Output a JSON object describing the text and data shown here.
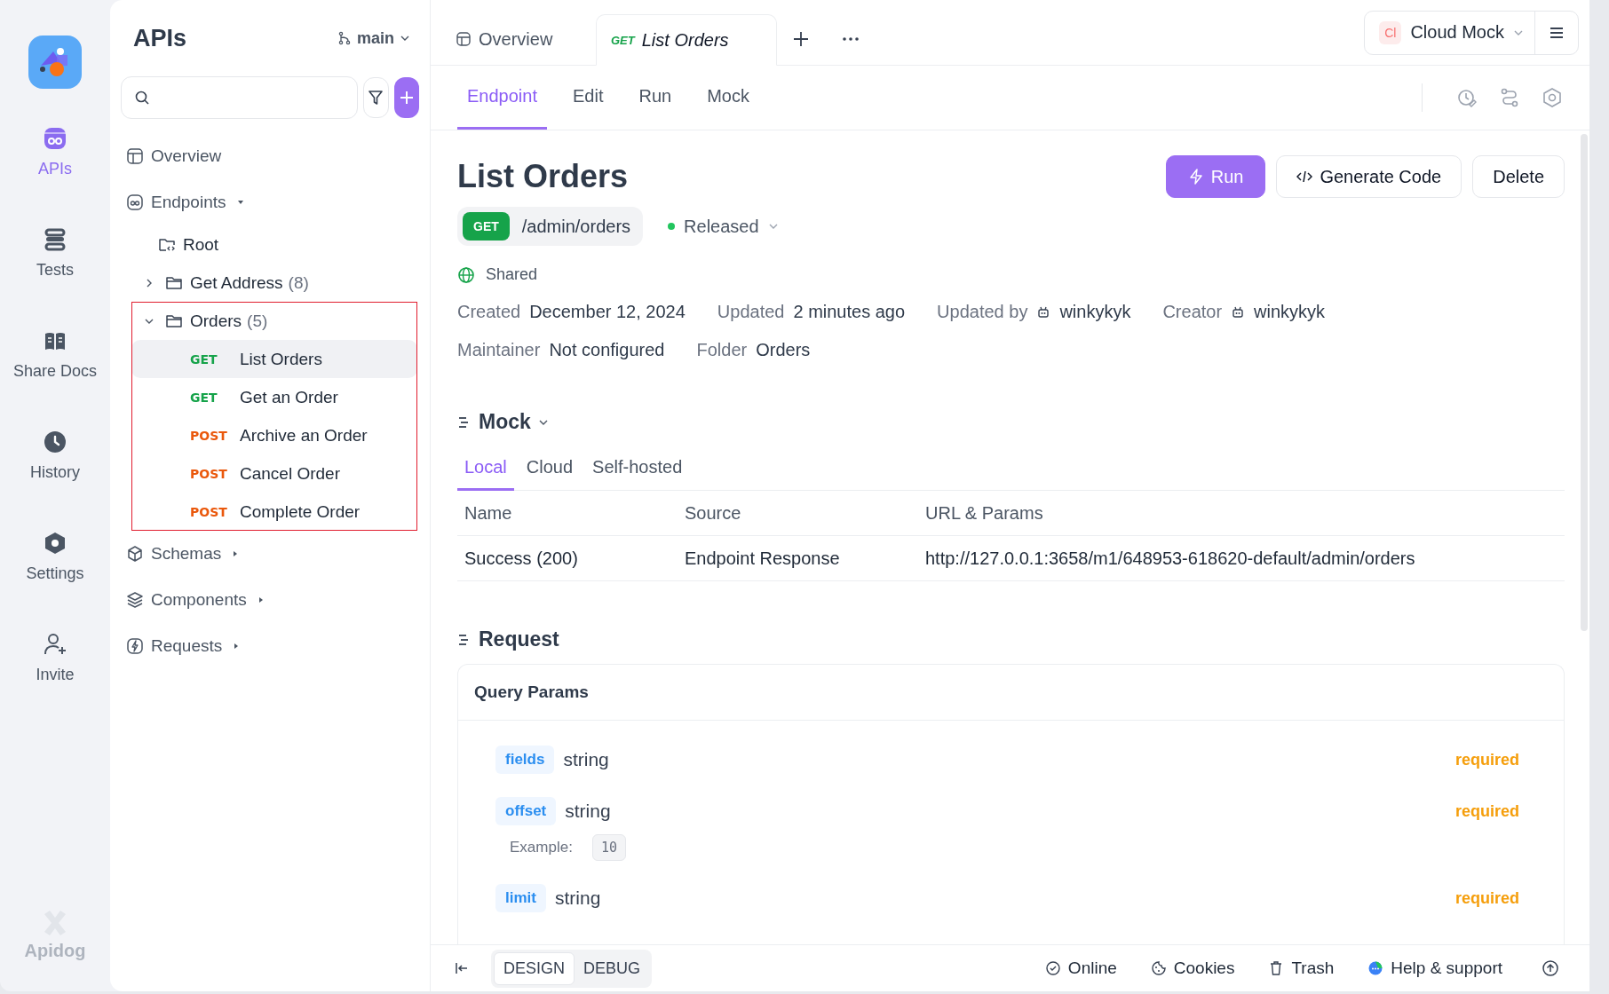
{
  "rail": {
    "items": [
      {
        "label": "APIs",
        "selected": true
      },
      {
        "label": "Tests",
        "selected": false
      },
      {
        "label": "Share Docs",
        "selected": false
      },
      {
        "label": "History",
        "selected": false
      },
      {
        "label": "Settings",
        "selected": false
      },
      {
        "label": "Invite",
        "selected": false
      }
    ],
    "brand": "Apidog"
  },
  "sidebar": {
    "title": "APIs",
    "branch": "main",
    "tree": [
      {
        "kind": "page",
        "label": "Overview"
      },
      {
        "kind": "section",
        "label": "Endpoints",
        "expanded": true,
        "children": [
          {
            "kind": "root",
            "label": "Root"
          },
          {
            "kind": "folder",
            "label": "Get Address",
            "count": "(8)",
            "expanded": false,
            "annotated": false
          },
          {
            "kind": "folder",
            "label": "Orders",
            "count": "(5)",
            "expanded": true,
            "annotated": true,
            "children": [
              {
                "kind": "endpoint",
                "method": "GET",
                "color": "#16a34a",
                "label": "List Orders",
                "selected": true
              },
              {
                "kind": "endpoint",
                "method": "GET",
                "color": "#16a34a",
                "label": "Get an Order",
                "selected": false
              },
              {
                "kind": "endpoint",
                "method": "POST",
                "color": "#ea580c",
                "label": "Archive an Order",
                "selected": false
              },
              {
                "kind": "endpoint",
                "method": "POST",
                "color": "#ea580c",
                "label": "Cancel Order",
                "selected": false
              },
              {
                "kind": "endpoint",
                "method": "POST",
                "color": "#ea580c",
                "label": "Complete Order",
                "selected": false
              }
            ]
          }
        ]
      },
      {
        "kind": "section",
        "label": "Schemas",
        "expanded": false
      },
      {
        "kind": "section",
        "label": "Components",
        "expanded": false
      },
      {
        "kind": "section",
        "label": "Requests",
        "expanded": false
      }
    ]
  },
  "tabs": [
    {
      "label": "Overview",
      "selected": false
    },
    {
      "method": "GET",
      "label": "List Orders",
      "selected": true
    }
  ],
  "environment": {
    "badge": "Cl",
    "label": "Cloud Mock"
  },
  "subtabs": [
    {
      "label": "Endpoint",
      "selected": true
    },
    {
      "label": "Edit",
      "selected": false
    },
    {
      "label": "Run",
      "selected": false
    },
    {
      "label": "Mock",
      "selected": false
    }
  ],
  "endpoint": {
    "title": "List Orders",
    "method": "GET",
    "path": "/admin/orders",
    "status": {
      "label": "Released",
      "color": "#22c55e"
    },
    "visibility": "Shared",
    "actions": [
      {
        "label": "Run",
        "kind": "primary"
      },
      {
        "label": "Generate Code",
        "kind": "code"
      },
      {
        "label": "Delete",
        "kind": "plain"
      }
    ],
    "meta": [
      [
        {
          "label": "Created",
          "value": "December 12, 2024",
          "kind": "text"
        },
        {
          "label": "Updated",
          "value": "2 minutes ago",
          "kind": "text"
        },
        {
          "label": "Updated by",
          "value": "winkykyk",
          "kind": "user"
        },
        {
          "label": "Creator",
          "value": "winkykyk",
          "kind": "user"
        }
      ],
      [
        {
          "label": "Maintainer",
          "value": "Not configured",
          "kind": "text"
        },
        {
          "label": "Folder",
          "value": "Orders",
          "kind": "text"
        }
      ]
    ]
  },
  "mock": {
    "title": "Mock",
    "tabs": [
      {
        "label": "Local",
        "selected": true
      },
      {
        "label": "Cloud",
        "selected": false
      },
      {
        "label": "Self-hosted",
        "selected": false
      }
    ],
    "columns": [
      "Name",
      "Source",
      "URL & Params"
    ],
    "rows": [
      [
        "Success (200)",
        "Endpoint Response",
        "http://127.0.0.1:3658/m1/648953-618620-default/admin/orders"
      ]
    ]
  },
  "request": {
    "title": "Request",
    "card_title": "Query Params",
    "params": [
      {
        "name": "fields",
        "type": "string",
        "flag": "required"
      },
      {
        "name": "offset",
        "type": "string",
        "flag": "required",
        "example_label": "Example:",
        "example": "10"
      },
      {
        "name": "limit",
        "type": "string",
        "flag": "required"
      }
    ]
  },
  "footer": {
    "modes": [
      {
        "label": "DESIGN",
        "selected": true
      },
      {
        "label": "DEBUG",
        "selected": false
      }
    ],
    "links": [
      "Online",
      "Cookies",
      "Trash",
      "Help & support"
    ]
  }
}
